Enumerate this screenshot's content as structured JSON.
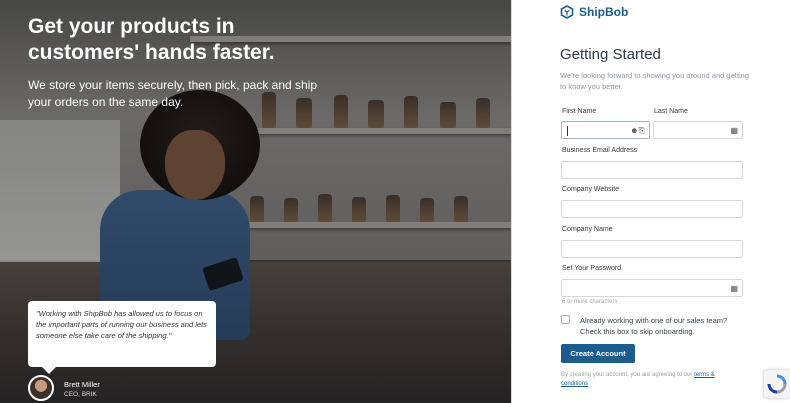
{
  "hero": {
    "headline": "Get your products in customers' hands faster.",
    "subheadline": "We store your items securely, then pick, pack and ship your orders on the same day.",
    "testimonial": {
      "quote": "\"Working with ShipBob has allowed us to focus on the important parts of running our business and lets someone else take care of the shipping.\"",
      "author_name": "Brett Miller",
      "author_role": "CEO, BRIK"
    }
  },
  "brand": {
    "name": "ShipBob",
    "logo_icon": "shipbob-logo-icon",
    "color": "#1b5d8f"
  },
  "form": {
    "title": "Getting Started",
    "intro": "We're looking forward to showing you around and getting to know you better.",
    "first_name": {
      "label": "First Name",
      "value": ""
    },
    "last_name": {
      "label": "Last Name",
      "value": ""
    },
    "email": {
      "label": "Business Email Address",
      "value": ""
    },
    "website": {
      "label": "Company Website",
      "value": ""
    },
    "company": {
      "label": "Company Name",
      "value": ""
    },
    "password": {
      "label": "Set Your Password",
      "value": "",
      "hint": "6 or more characters"
    },
    "sales_checkbox": {
      "label": "Already working with one of our sales team? Check this box to skip onboarding.",
      "checked": false
    },
    "submit_label": "Create Account",
    "terms_prefix": "By creating your account, you are agreeing to our ",
    "terms_link": "terms & conditions"
  }
}
